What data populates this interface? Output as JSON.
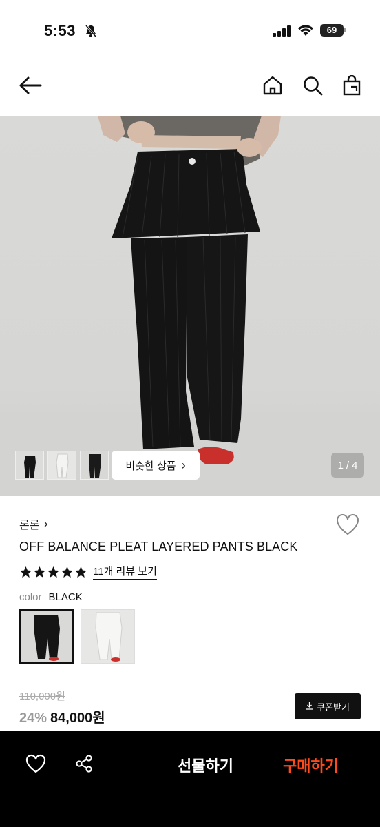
{
  "status_bar": {
    "time": "5:53",
    "battery": "69"
  },
  "colors": {
    "accent": "#ff4a1c",
    "discount": "#9a9a9a",
    "pants": "#151515"
  },
  "gallery": {
    "similar_label": "비슷한 상품",
    "similar_chevron": "›",
    "current": "1",
    "separator": "/",
    "total": "4"
  },
  "product": {
    "brand": "론론",
    "brand_chevron": "›",
    "name": "OFF BALANCE PLEAT LAYERED PANTS BLACK",
    "rating": 5,
    "review_link": "11개 리뷰 보기",
    "color_label": "color",
    "color_value": "BLACK",
    "original_price": "110,000원",
    "discount_rate": "24%",
    "sale_price": "84,000원",
    "coupon_label": "쿠폰받기"
  },
  "bottom_bar": {
    "gift_label": "선물하기",
    "buy_label": "구매하기"
  },
  "icons": [
    "bell-off-icon",
    "signal-icon",
    "wifi-icon",
    "back-arrow-icon",
    "home-icon",
    "search-icon",
    "shopping-bag-icon",
    "heart-icon",
    "star-icon",
    "download-icon",
    "share-icon"
  ]
}
